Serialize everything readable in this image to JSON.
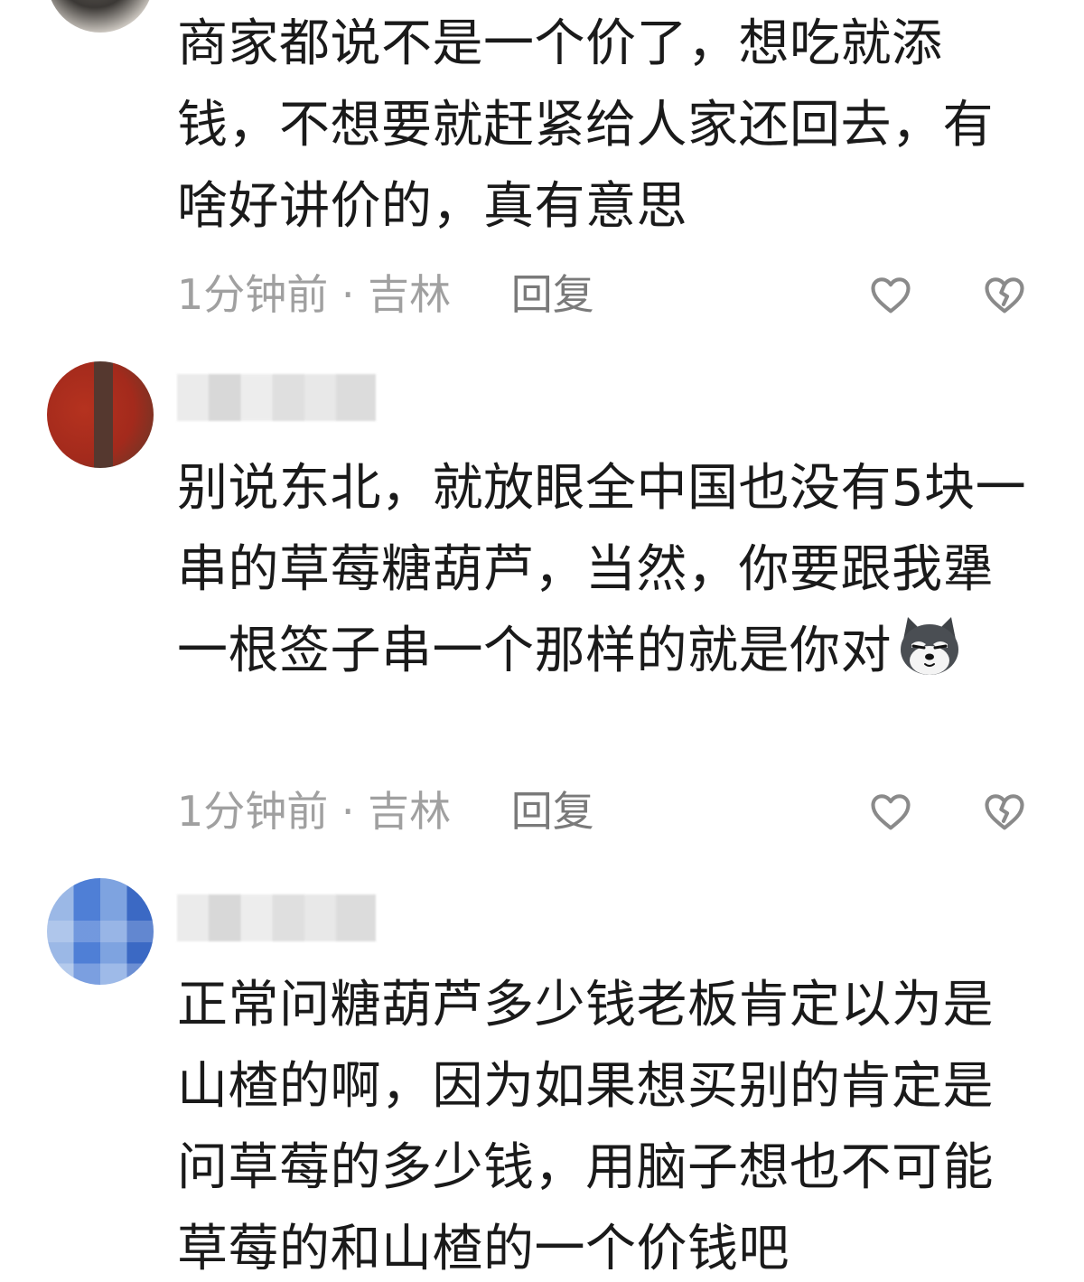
{
  "comments": [
    {
      "text": "商家都说不是一个价了，想吃就添钱，不想要就赶紧给人家还回去，有啥好讲价的，真有意思",
      "time": "1分钟前",
      "separator": "·",
      "location": "吉林",
      "reply_label": "回复",
      "like_icon": "heart-outline-icon",
      "dislike_icon": "broken-heart-icon"
    },
    {
      "username": "",
      "text": "别说东北，就放眼全中国也没有5块一串的草莓糖葫芦，当然，你要跟我犟一根签子串一个那样的就是你对",
      "emoji": "husky-dog-emoji",
      "time": "1分钟前",
      "separator": "·",
      "location": "吉林",
      "reply_label": "回复",
      "like_icon": "heart-outline-icon",
      "dislike_icon": "broken-heart-icon"
    },
    {
      "username": "",
      "text": "正常问糖葫芦多少钱老板肯定以为是山楂的啊，因为如果想买别的肯定是问草莓的多少钱，用脑子想也不可能草莓的和山楂的一个价钱吧"
    }
  ],
  "colors": {
    "text": "#1a1a1a",
    "meta": "#a0a0a0",
    "reply": "#7a7a7a",
    "icon": "#8a8a8a"
  }
}
